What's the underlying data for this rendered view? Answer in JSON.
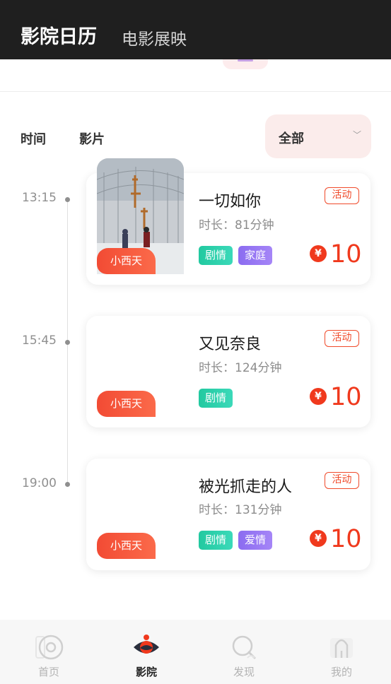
{
  "header": {
    "title": "影院日历",
    "subtitle": "电影展映"
  },
  "filters": {
    "time_label": "时间",
    "film_label": "影片",
    "select_value": "全部"
  },
  "colors": {
    "accent": "#f0391d",
    "header_bg": "#1f1f1f",
    "genre_teal": "#22c9a0",
    "genre_purple": "#8b6cf0"
  },
  "screenings": [
    {
      "time": "13:15",
      "title": "一切如你",
      "duration": "时长：81分钟",
      "badge": "活动",
      "cinema": "小西天",
      "genres": [
        "剧情",
        "家庭"
      ],
      "currency": "¥",
      "price": "10"
    },
    {
      "time": "15:45",
      "title": "又见奈良",
      "duration": "时长：124分钟",
      "badge": "活动",
      "cinema": "小西天",
      "genres": [
        "剧情"
      ],
      "currency": "¥",
      "price": "10"
    },
    {
      "time": "19:00",
      "title": "被光抓走的人",
      "duration": "时长：131分钟",
      "badge": "活动",
      "cinema": "小西天",
      "genres": [
        "剧情",
        "爱情"
      ],
      "currency": "¥",
      "price": "10"
    }
  ],
  "tabbar": {
    "items": [
      {
        "label": "首页",
        "icon": "disc-icon"
      },
      {
        "label": "影院",
        "icon": "cinema-eye-icon",
        "active": true
      },
      {
        "label": "发现",
        "icon": "discover-icon"
      },
      {
        "label": "我的",
        "icon": "profile-icon"
      }
    ]
  }
}
